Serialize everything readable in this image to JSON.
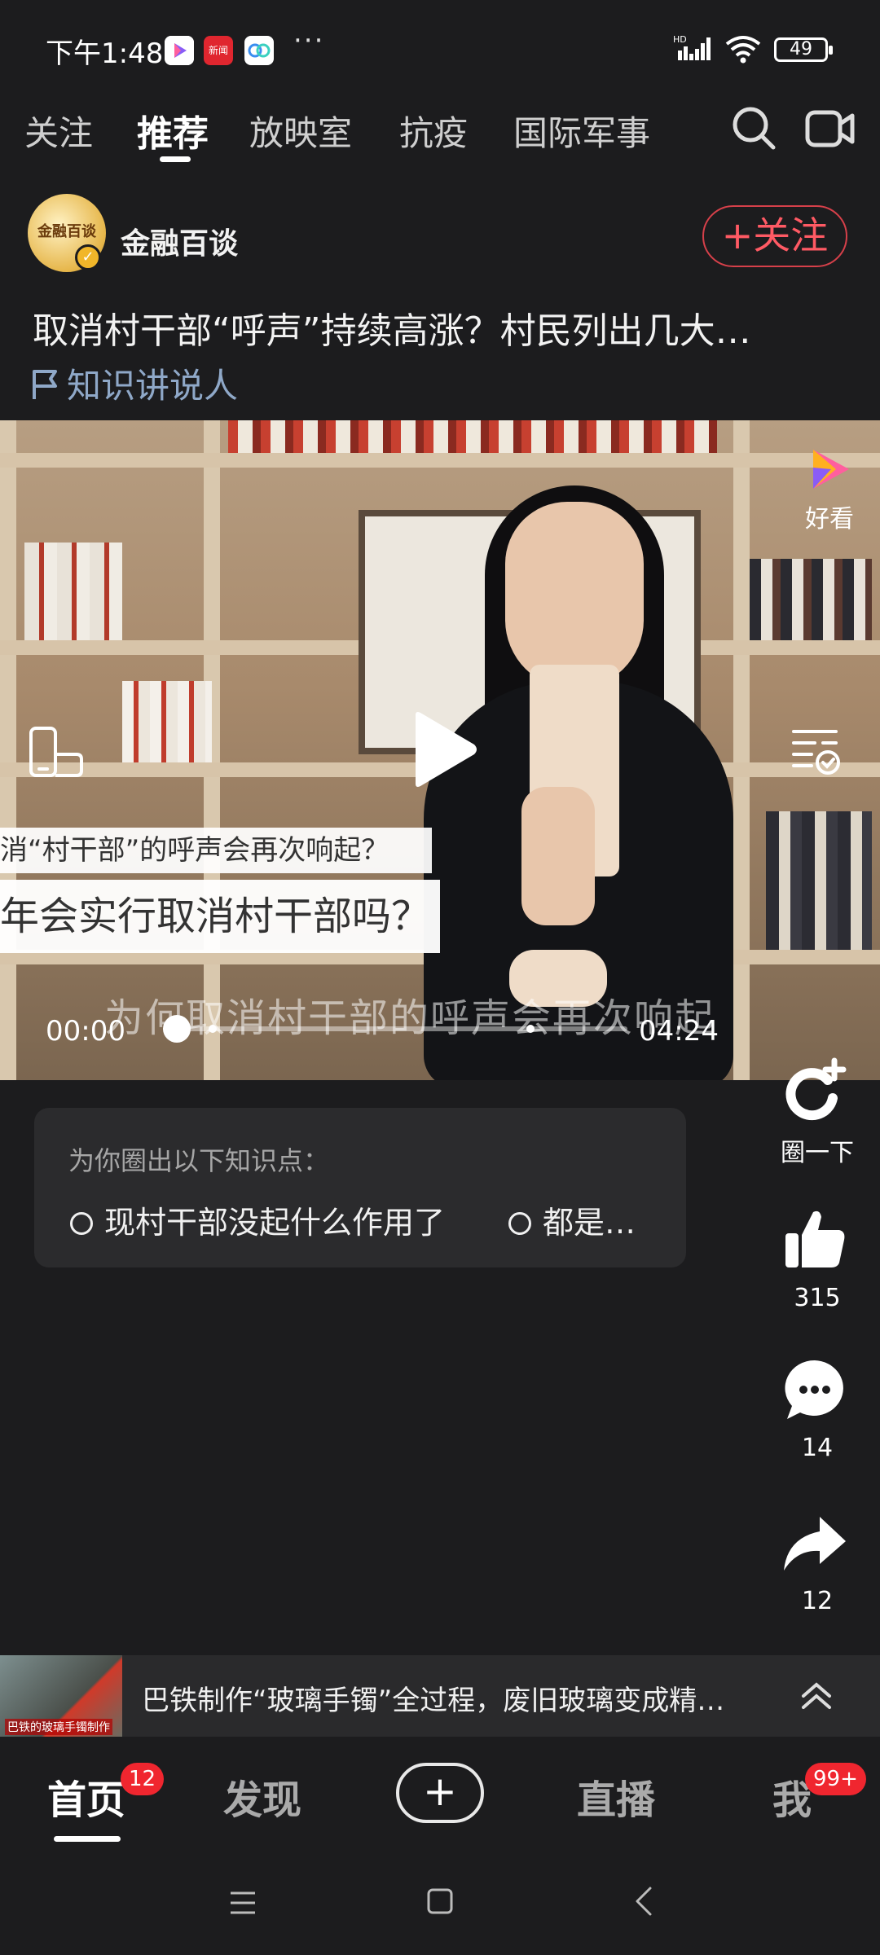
{
  "status_bar": {
    "time": "下午1:48",
    "battery": "49",
    "apps": [
      "video-app",
      "news-app",
      "cloud-app"
    ],
    "news_app_label": "新闻"
  },
  "top_tabs": [
    "关注",
    "推荐",
    "放映室",
    "抗疫",
    "国际军事"
  ],
  "active_tab": "推荐",
  "author": {
    "name": "金融百谈",
    "avatar_text": "金融百谈",
    "follow_label": "+关注"
  },
  "post": {
    "title": "取消村干部“呼声”持续高涨？村民列出几大…",
    "tag": "知识讲说人"
  },
  "video": {
    "logo_text": "好看",
    "caption_1": "取消“村干部”的呼声会再次响起？",
    "caption_2": "年会实行取消村干部吗？",
    "subtitle": "为何取消村干部的呼声会再次响起",
    "time_current": "00:00",
    "time_total": "04:24",
    "progress": 0.0
  },
  "knowledge": {
    "heading": "为你圈出以下知识点：",
    "items": [
      "现村干部没起什么作用了",
      "都是…"
    ]
  },
  "rail": {
    "circle_label": "圈一下",
    "like_count": "315",
    "comment_count": "14",
    "share_count": "12"
  },
  "recommend": {
    "thumb_text": "巴铁的玻璃手镯制作",
    "text": "巴铁制作“玻璃手镯”全过程，废旧玻璃变成精…"
  },
  "bottom_nav": {
    "home": "首页",
    "home_badge": "12",
    "discover": "发现",
    "plus": "+",
    "live": "直播",
    "me": "我",
    "me_badge": "99+"
  },
  "colors": {
    "background": "#1c1c1e",
    "accent_red": "#ff5a64",
    "badge_red": "#f0262f",
    "tag_blue": "#8fa8c8"
  }
}
